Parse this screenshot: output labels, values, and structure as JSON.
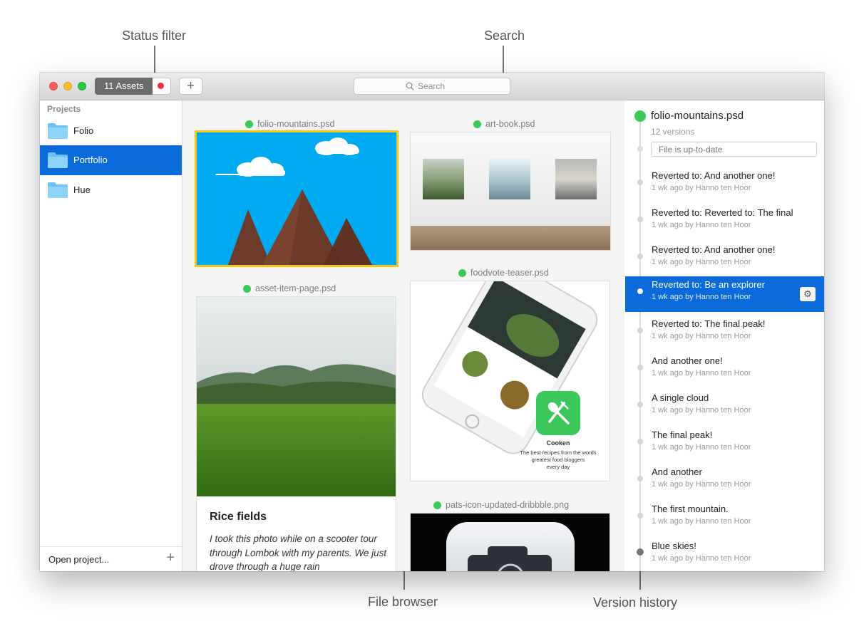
{
  "annotations": {
    "status_filter": "Status filter",
    "search": "Search",
    "file_browser": "File browser",
    "version_history": "Version history"
  },
  "toolbar": {
    "assets_count": "11 Assets",
    "add_label": "+",
    "search_placeholder": "Search"
  },
  "sidebar": {
    "heading": "Projects",
    "projects": [
      {
        "label": "Folio",
        "selected": false
      },
      {
        "label": "Portfolio",
        "selected": true
      },
      {
        "label": "Hue",
        "selected": false
      }
    ],
    "open_project": "Open project...",
    "add_label": "+"
  },
  "browser": {
    "files": [
      {
        "name": "folio-mountains.psd",
        "selected": true
      },
      {
        "name": "art-book.psd",
        "selected": false
      },
      {
        "name": "asset-item-page.psd",
        "selected": false
      },
      {
        "name": "foodvote-teaser.psd",
        "selected": false
      },
      {
        "name": "pats-icon-updated-dribbble.png",
        "selected": false
      }
    ],
    "article": {
      "title": "Rice fields",
      "body": "I took this photo while on a scooter tour through Lombok with my parents. We just drove through a huge rain"
    },
    "app_promo": {
      "app_name": "Cooken",
      "tagline_1": "The best recipes from the words",
      "tagline_2": "greatest food bloggers",
      "tagline_3": "every day"
    }
  },
  "history": {
    "file_name": "folio-mountains.psd",
    "version_count": "12 versions",
    "commit_placeholder": "File is up-to-date",
    "versions": [
      {
        "title": "Reverted to: And another one!",
        "meta": "1 wk ago by Hanno ten Hoor"
      },
      {
        "title": "Reverted to: Reverted to: The final",
        "meta": "1 wk ago by Hanno ten Hoor"
      },
      {
        "title": "Reverted to: And another one!",
        "meta": "1 wk ago by Hanno ten Hoor"
      },
      {
        "title": "Reverted to: Be an explorer",
        "meta": "1 wk ago by Hanno ten Hoor",
        "selected": true
      },
      {
        "title": "Reverted to: The final peak!",
        "meta": "1 wk ago by Hanno ten Hoor"
      },
      {
        "title": "And another one!",
        "meta": "1 wk ago by Hanno ten Hoor"
      },
      {
        "title": "A single cloud",
        "meta": "1 wk ago by Hanno ten Hoor"
      },
      {
        "title": "The final peak!",
        "meta": "1 wk ago by Hanno ten Hoor"
      },
      {
        "title": "And another",
        "meta": "1 wk ago by Hanno ten Hoor"
      },
      {
        "title": "The first mountain.",
        "meta": "1 wk ago by Hanno ten Hoor"
      },
      {
        "title": "Blue skies!",
        "meta": "1 wk ago by Hanno ten Hoor"
      }
    ]
  },
  "colors": {
    "selection_blue": "#0c6bdb",
    "status_green": "#3cc85a",
    "filter_red": "#f02d47",
    "highlight_yellow": "#f5c518",
    "sky_blue": "#00aaf0"
  },
  "icons": {
    "folder": "folder-icon",
    "search": "search-icon",
    "gear": "gear-icon",
    "plus": "plus-icon"
  }
}
